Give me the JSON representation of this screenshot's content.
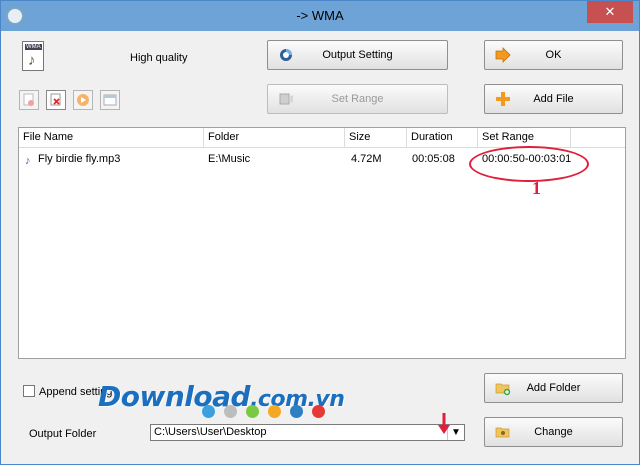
{
  "window": {
    "title": "-> WMA",
    "close_glyph": "✕"
  },
  "format_icon": {
    "tag": "WMA",
    "icon": "music-file-icon"
  },
  "quality_label": "High quality",
  "buttons": {
    "output_setting": "Output Setting",
    "ok": "OK",
    "set_range": "Set Range",
    "add_file": "Add File",
    "add_folder": "Add Folder",
    "change": "Change"
  },
  "table": {
    "columns": [
      "File Name",
      "Folder",
      "Size",
      "Duration",
      "Set Range"
    ],
    "rows": [
      {
        "file_name": "Fly birdie fly.mp3",
        "folder": "E:\\Music",
        "size": "4.72M",
        "duration": "00:05:08",
        "set_range": "00:00:50-00:03:01"
      }
    ]
  },
  "annotation_number": "1",
  "append_label": "Append setting",
  "watermark": {
    "text": "Download",
    "domain": ".com.vn"
  },
  "dot_colors": [
    "#3aa0e0",
    "#bdbdbd",
    "#7ac943",
    "#f7a823",
    "#2b7fc3",
    "#e53935"
  ],
  "accent_red": "#e0203a",
  "output_folder": {
    "label": "Output Folder",
    "value": "C:\\Users\\User\\Desktop"
  }
}
